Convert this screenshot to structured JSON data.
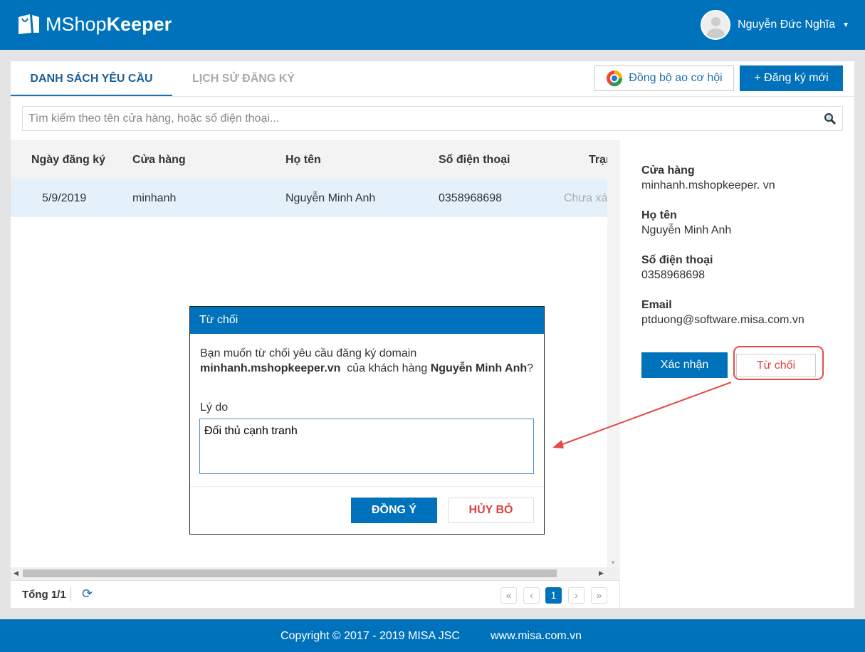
{
  "header": {
    "logo_light": "MShop",
    "logo_bold": "Keeper",
    "user_name": "Nguyễn Đức Nghĩa"
  },
  "tabs": [
    {
      "label": "DANH SÁCH YÊU CẦU"
    },
    {
      "label": "LỊCH SỬ ĐĂNG KÝ"
    }
  ],
  "toolbar": {
    "sync_label": "Đồng bộ ao cơ hội",
    "register_label": "+ Đăng ký mới"
  },
  "search": {
    "placeholder": "Tìm kiếm theo tên cửa hàng, hoặc số điện thoại..."
  },
  "table": {
    "columns": [
      "Ngày đăng ký",
      "Cửa hàng",
      "Họ tên",
      "Số điện thoại",
      "Trạng"
    ],
    "rows": [
      {
        "date": "5/9/2019",
        "store": "minhanh",
        "name": "Nguyễn Minh Anh",
        "phone": "0358968698",
        "status": "Chưa xác"
      }
    ]
  },
  "pager": {
    "total": "Tổng 1/1",
    "first": "«",
    "prev": "‹",
    "current": "1",
    "next": "›",
    "last": "»"
  },
  "detail": {
    "store_label": "Cửa hàng",
    "store": "minhanh.mshopkeeper. vn",
    "name_label": "Họ tên",
    "name": "Nguyễn Minh Anh",
    "phone_label": "Số điện thoại",
    "phone": "0358968698",
    "email_label": "Email",
    "email": "ptduong@software.misa.com.vn",
    "confirm": "Xác nhận",
    "reject": "Từ chối"
  },
  "modal": {
    "title": "Từ chối",
    "text1": "Bạn muốn từ chối yêu cầu đăng ký domain",
    "domain": "minhanh.mshopkeeper.vn",
    "text2": "của khách hàng",
    "customer": "Nguyễn Minh Anh",
    "q": "?",
    "reason_label": "Lý do",
    "reason": "Đối thủ cạnh tranh",
    "agree": "ĐỒNG Ý",
    "cancel": "HỦY BỎ"
  },
  "footer": {
    "copyright": "Copyright © 2017 - 2019 MISA JSC",
    "website": "www.misa.com.vn"
  },
  "colors": {
    "brand": "#0072bc",
    "danger": "#e34a4a"
  }
}
